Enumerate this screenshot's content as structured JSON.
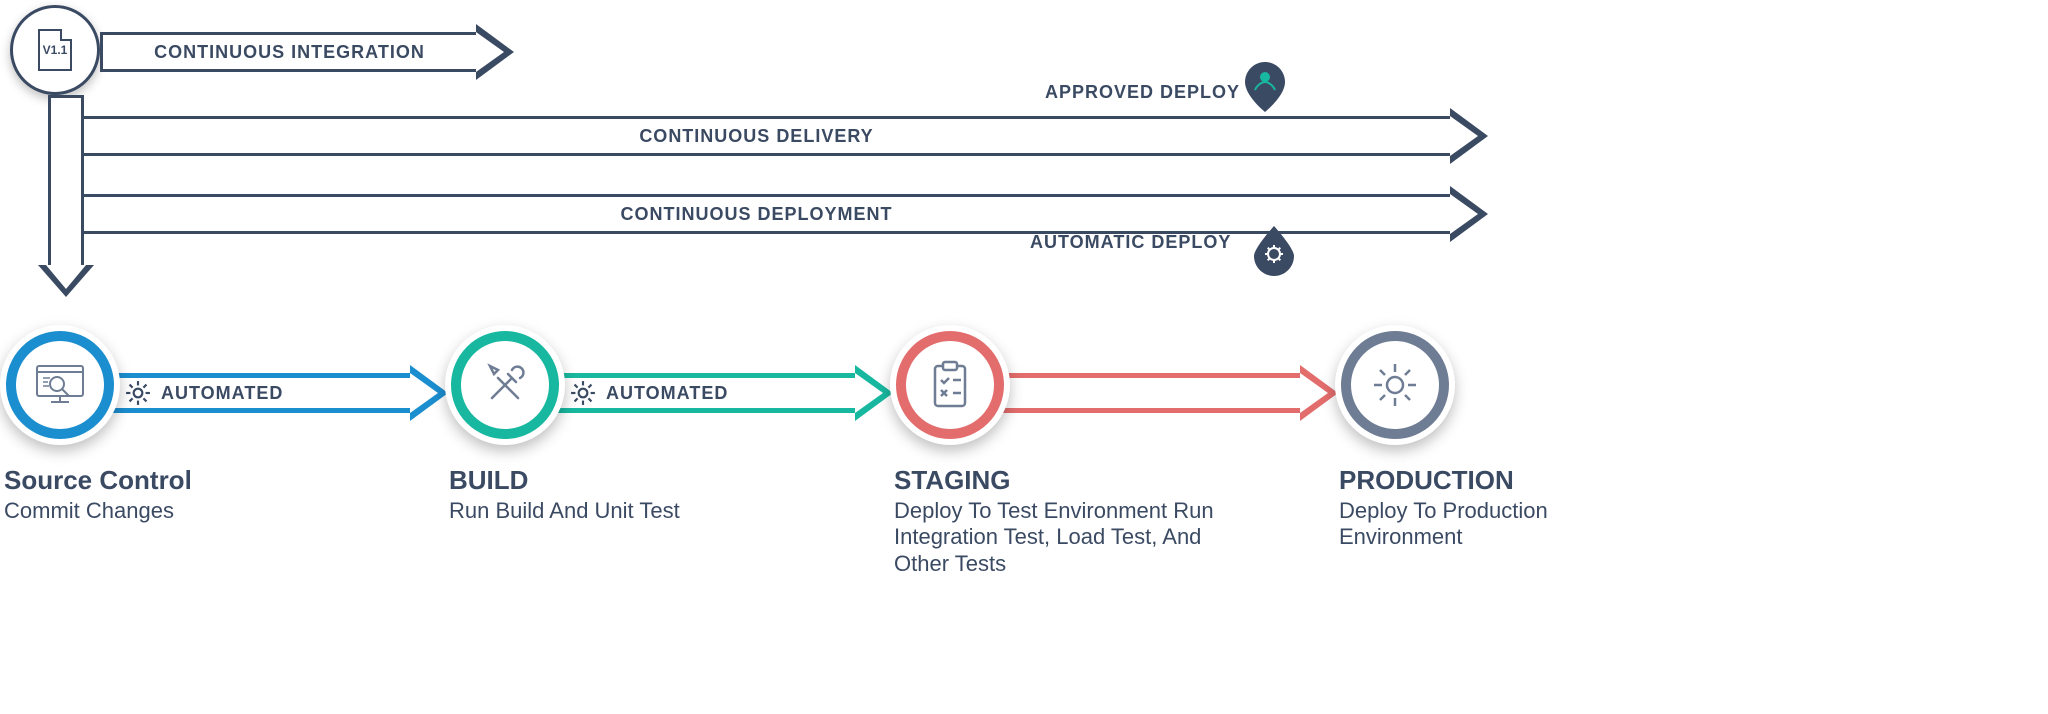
{
  "version_label": "V1.1",
  "arrows": {
    "ci": "CONTINUOUS INTEGRATION",
    "cd1": "CONTINUOUS DELIVERY",
    "cd2": "CONTINUOUS DEPLOYMENT"
  },
  "deploy": {
    "approved": "APPROVED DEPLOY",
    "automatic": "AUTOMATIC DEPLOY"
  },
  "connector_label": "AUTOMATED",
  "stages": [
    {
      "title": "Source Control",
      "desc": "Commit Changes"
    },
    {
      "title": "BUILD",
      "desc": "Run Build And Unit Test"
    },
    {
      "title": "STAGING",
      "desc": "Deploy To Test Environment Run Integration Test, Load Test, And Other Tests"
    },
    {
      "title": "PRODUCTION",
      "desc": "Deploy To Production Environment"
    }
  ]
}
